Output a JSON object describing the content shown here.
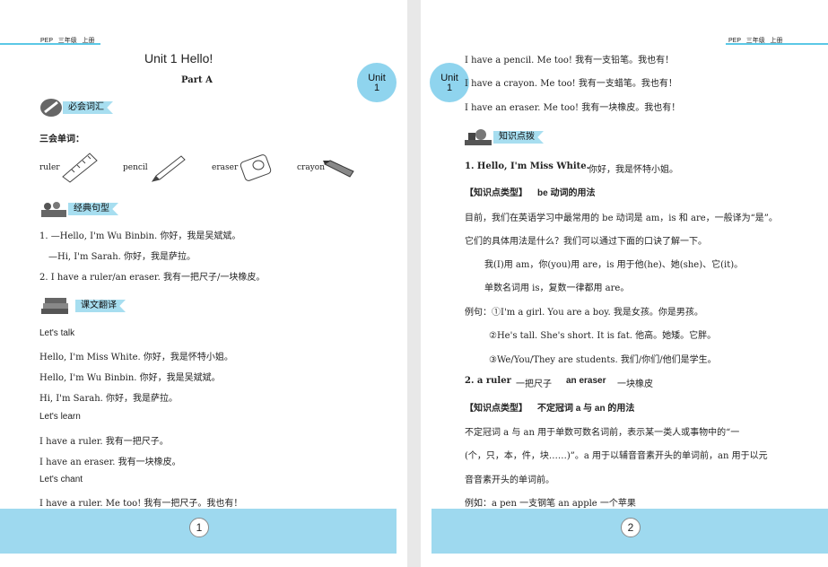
{
  "page1": {
    "header": "PEP   三年级   上册",
    "title": "Unit 1    Hello!",
    "subtitle": "Part   A",
    "badge": {
      "unit": "Unit",
      "num": "1"
    },
    "sections": {
      "vocab": "必会词汇",
      "sentences": "经典句型",
      "translation": "课文翻译"
    },
    "sanhui": "三会单词：",
    "words": [
      "ruler",
      "pencil",
      "eraser",
      "crayon"
    ],
    "sentence_lines": [
      "1. —Hello, I'm Wu Binbin.    你好，我是吴斌斌。",
      "—Hi, I'm Sarah.     你好，我是萨拉。",
      "2. I have a ruler/an eraser.    我有一把尺子/一块橡皮。"
    ],
    "talk_heading": "Let's talk",
    "talk_lines": [
      "Hello, I'm Miss White.    你好，我是怀特小姐。",
      "Hello, I'm Wu Binbin.    你好，我是吴斌斌。",
      "Hi, I'm Sarah.    你好，我是萨拉。"
    ],
    "learn_heading": "Let's learn",
    "learn_lines": [
      "I have a ruler.    我有一把尺子。",
      "I have an eraser.    我有一块橡皮。"
    ],
    "chant_heading": "Let's chant",
    "chant_lines": [
      "I have a ruler. Me too! 我有一把尺子。我也有！"
    ],
    "page_number": "1"
  },
  "page2": {
    "header": "PEP   三年级   上册",
    "badge": {
      "unit": "Unit",
      "num": "1"
    },
    "top_lines": [
      "I have a pencil. Me too! 我有一支铅笔。我也有！",
      "I have a crayon. Me too! 我有一支蜡笔。我也有！",
      "I have an eraser. Me too! 我有一块橡皮。我也有！"
    ],
    "section": "知识点拨",
    "point1_title": "1. Hello, I'm Miss White.",
    "point1_cn": "你好，我是怀特小姐。",
    "type1_label": "【知识点类型】",
    "type1_text": "be 动词的用法",
    "para1": [
      "目前，我们在英语学习中最常用的 be 动词是 am，is 和 are，一般译为“是”。",
      "它们的具体用法是什么？我们可以通过下面的口诀了解一下。"
    ],
    "rhyme": [
      "我(I)用 am，你(you)用 are，is 用于他(he)、她(she)、它(it)。",
      "单数名词用 is，复数一律都用 are。"
    ],
    "examples": [
      "例句：①I'm a girl. You are a boy.    我是女孩。你是男孩。",
      "②He's tall. She's short. It is fat.    他高。她矮。它胖。",
      "③We/You/They are students.    我们/你们/他们是学生。"
    ],
    "point2_prefix": "2. a ruler",
    "point2_mid": "一把尺子",
    "point2_word": "an eraser",
    "point2_end": "一块橡皮",
    "type2_label": "【知识点类型】",
    "type2_text": "不定冠词 a 与 an 的用法",
    "para2": [
      "不定冠词 a 与 an 用于单数可数名词前，表示某一类人或事物中的“一",
      "(个，只，本，件，块……)”。a 用于以辅音音素开头的单词前，an 用于以元",
      "音音素开头的单词前。"
    ],
    "example_last": "例如：a pen    一支钢笔    an apple    一个苹果",
    "page_number": "2"
  },
  "colors": {
    "accent": "#9ed9ef",
    "line": "#5bc8e6"
  }
}
